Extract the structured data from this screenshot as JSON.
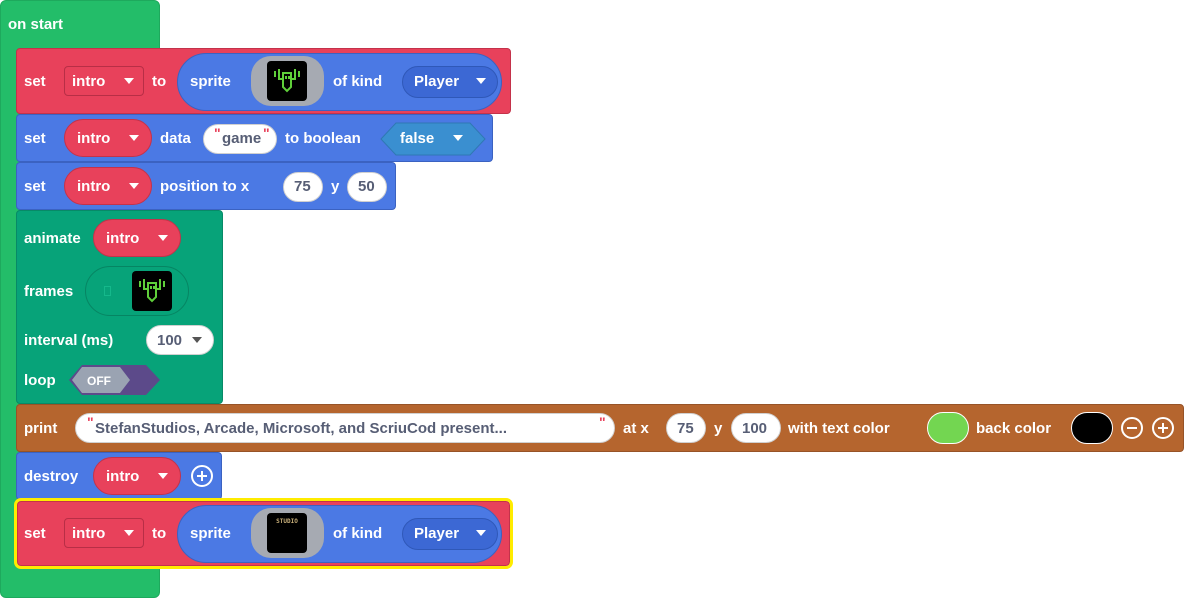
{
  "colors": {
    "hat": "#23bd69",
    "sprites_red": "#e8415b",
    "sprites_blue": "#4b79e4",
    "animation_green": "#07a379",
    "text_brown": "#b5652e",
    "selection_yellow": "#ffec00",
    "boolean_blue": "#3a8fd0",
    "text_color_green": "#73d651",
    "back_color_black": "#000000"
  },
  "hat": {
    "label": "on start"
  },
  "block1": {
    "set": "set",
    "variable": "intro",
    "to": "to",
    "sprite": "sprite",
    "of_kind": "of kind",
    "kind": "Player",
    "icon": "robot-sprite-icon"
  },
  "block2": {
    "set": "set",
    "variable": "intro",
    "data": "data",
    "key": "game",
    "to_boolean": "to boolean",
    "value": "false"
  },
  "block3": {
    "set": "set",
    "variable": "intro",
    "position_to_x": "position to x",
    "x": "75",
    "y_label": "y",
    "y": "50"
  },
  "block4": {
    "animate": "animate",
    "variable": "intro",
    "frames": "frames",
    "interval": "interval (ms)",
    "interval_value": "100",
    "loop": "loop",
    "loop_value": "OFF",
    "icon": "robot-sprite-icon"
  },
  "block5": {
    "print": "print",
    "text": "StefanStudios, Arcade, Microsoft, and ScriuCod present...",
    "at_x": "at x",
    "x": "75",
    "y_label": "y",
    "y": "100",
    "with_text_color": "with text color",
    "back_color": "back color"
  },
  "block6": {
    "destroy": "destroy",
    "variable": "intro"
  },
  "block7": {
    "set": "set",
    "variable": "intro",
    "to": "to",
    "sprite": "sprite",
    "of_kind": "of kind",
    "kind": "Player",
    "image_text": "STUDIO"
  }
}
